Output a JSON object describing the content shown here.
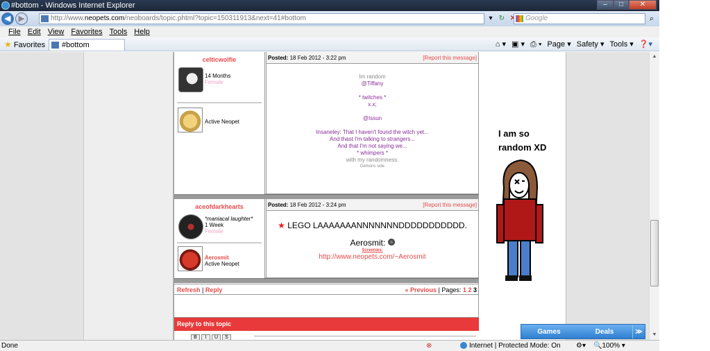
{
  "window": {
    "title": "#bottom - Windows Internet Explorer"
  },
  "address": {
    "url_prefix": "http://www.",
    "url_domain": "neopets.com",
    "url_path": "/neoboards/topic.phtml?topic=150311913&next=41#bottom",
    "search_placeholder": "Google"
  },
  "menu": [
    "File",
    "Edit",
    "View",
    "Favorites",
    "Tools",
    "Help"
  ],
  "favbar": {
    "favorites_label": "Favorites",
    "tab_title": "#bottom",
    "commands": [
      "Page ▾",
      "Safety ▾",
      "Tools ▾"
    ]
  },
  "posts": [
    {
      "author": "celticwolfie",
      "age": "14 Months",
      "gender": "Female",
      "pet_status": "Active Neopet",
      "posted_label": "Posted:",
      "posted_date": "18 Feb 2012 - 3:22 pm",
      "report": "[Report this message]",
      "lines": [
        {
          "text": "Im random",
          "color": "#888888"
        },
        {
          "text": "@Tiffany",
          "color": "#8a2b9a"
        },
        {
          "text": "",
          "color": "#000"
        },
        {
          "text": "* twitches *",
          "color": "#8a2b9a"
        },
        {
          "text": "x.x;",
          "color": "#8a2b9a"
        },
        {
          "text": "",
          "color": "#000"
        },
        {
          "text": "@Issun",
          "color": "#8a2b9a"
        },
        {
          "text": "",
          "color": "#000"
        },
        {
          "text": "Insaneley: That I haven't found the witch yet...",
          "color": "#8a2b9a"
        },
        {
          "text": "And thast I'm talking to strangers...",
          "color": "#8a2b9a"
        },
        {
          "text": "And that I'm not saying we...",
          "color": "#8a2b9a"
        },
        {
          "text": "* whimpers *",
          "color": "#8a2b9a"
        },
        {
          "text": "with my randomness.",
          "color": "#888888"
        }
      ],
      "sig": "Demons side"
    },
    {
      "author": "aceofdarkhearts",
      "tagline": "*maniacal laughter*",
      "age": "1 Week",
      "gender": "Female",
      "pet_name": "Aerosmit",
      "pet_status": "Active Neopet",
      "posted_label": "Posted:",
      "posted_date": "18 Feb 2012 - 3:24 pm",
      "report": "[Report this message]",
      "main_line": "LEGO LAAAAAAANNNNNNNDDDDDDDDDDD.",
      "sig_name": "Aerosmit:",
      "sig_label": "Screenies:",
      "sig_link": "http://www.neopets.com/~Aerosmit"
    }
  ],
  "footer": {
    "refresh": "Refresh",
    "divider": "|",
    "reply": "Reply",
    "previous": "« Previous",
    "pages_label": "Pages:",
    "page1": "1",
    "page2": "2",
    "page3": "3"
  },
  "reply_box": {
    "title": "Reply to this topic",
    "buttons": [
      "B",
      "I",
      "U",
      "S"
    ]
  },
  "side_art": {
    "line1": "I am so",
    "line2": "random XD"
  },
  "status": {
    "left": "Done",
    "zone": "Internet | Protected Mode: On",
    "zoom": "100%"
  },
  "promo": {
    "games": "Games",
    "deals": "Deals"
  }
}
